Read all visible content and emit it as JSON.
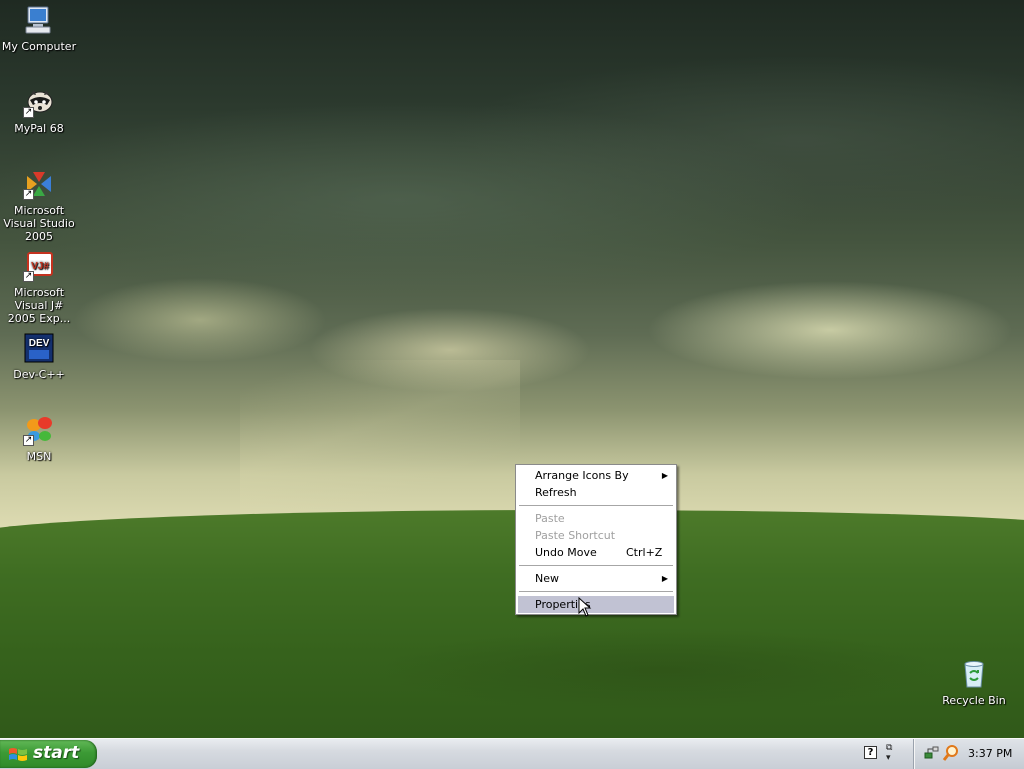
{
  "desktop": {
    "icons": [
      {
        "label": "My Computer"
      },
      {
        "label": "MyPal 68"
      },
      {
        "label": "Microsoft Visual Studio 2005"
      },
      {
        "label": "Microsoft Visual J# 2005 Exp..."
      },
      {
        "label": "Dev-C++"
      },
      {
        "label": "MSN"
      },
      {
        "label": "Recycle Bin"
      }
    ],
    "vj_badge": "VJ#",
    "dev_badge": "DEV"
  },
  "context_menu": {
    "items": [
      {
        "label": "Arrange Icons By",
        "submenu": true,
        "enabled": true
      },
      {
        "label": "Refresh",
        "enabled": true
      },
      {
        "label": "Paste",
        "enabled": false
      },
      {
        "label": "Paste Shortcut",
        "enabled": false
      },
      {
        "label": "Undo Move",
        "shortcut": "Ctrl+Z",
        "enabled": true
      },
      {
        "label": "New",
        "submenu": true,
        "enabled": true
      },
      {
        "label": "Properties",
        "enabled": true,
        "highlighted": true
      }
    ]
  },
  "taskbar": {
    "start_label": "start",
    "help_glyph": "?",
    "clock": "3:37 PM"
  },
  "colors": {
    "start_green": "#3c9a35",
    "menu_highlight": "#c1c2d3",
    "taskbar": "#d6dae0"
  }
}
